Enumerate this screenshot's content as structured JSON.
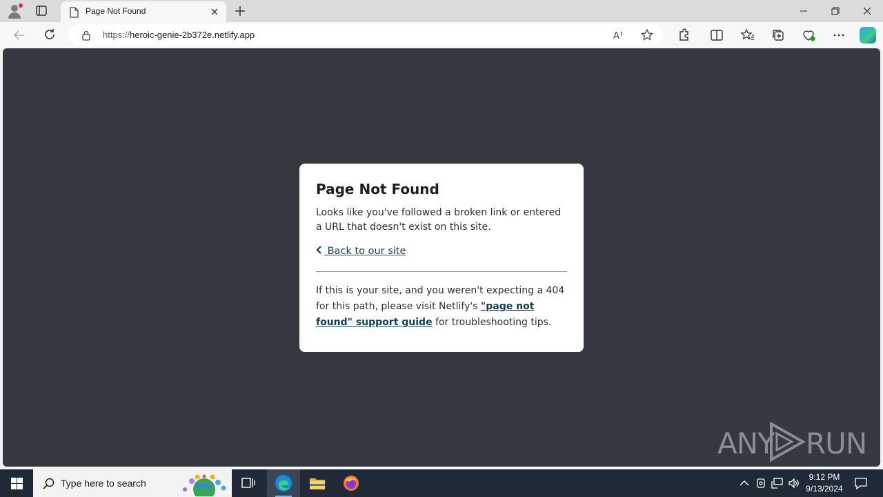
{
  "browser": {
    "tab_title": "Page Not Found",
    "url_scheme": "https://",
    "url_host": "heroic-genie-2b372e.netlify.app"
  },
  "page": {
    "heading": "Page Not Found",
    "lead": "Looks like you've followed a broken link or entered a URL that doesn't exist on this site.",
    "back_link": " Back to our site",
    "foot_pre": "If this is your site, and you weren't expecting a 404 for this path, please visit Netlify's ",
    "foot_link": "\"page not found\" support guide",
    "foot_post": " for troubleshooting tips."
  },
  "watermark": {
    "left": "ANY",
    "right": "RUN"
  },
  "taskbar": {
    "search_placeholder": "Type here to search",
    "time": "9:12 PM",
    "date": "9/13/2024"
  },
  "colors": {
    "page_bg": "#35383f",
    "link": "#0d3f59",
    "taskbar": "#1f2a36"
  }
}
